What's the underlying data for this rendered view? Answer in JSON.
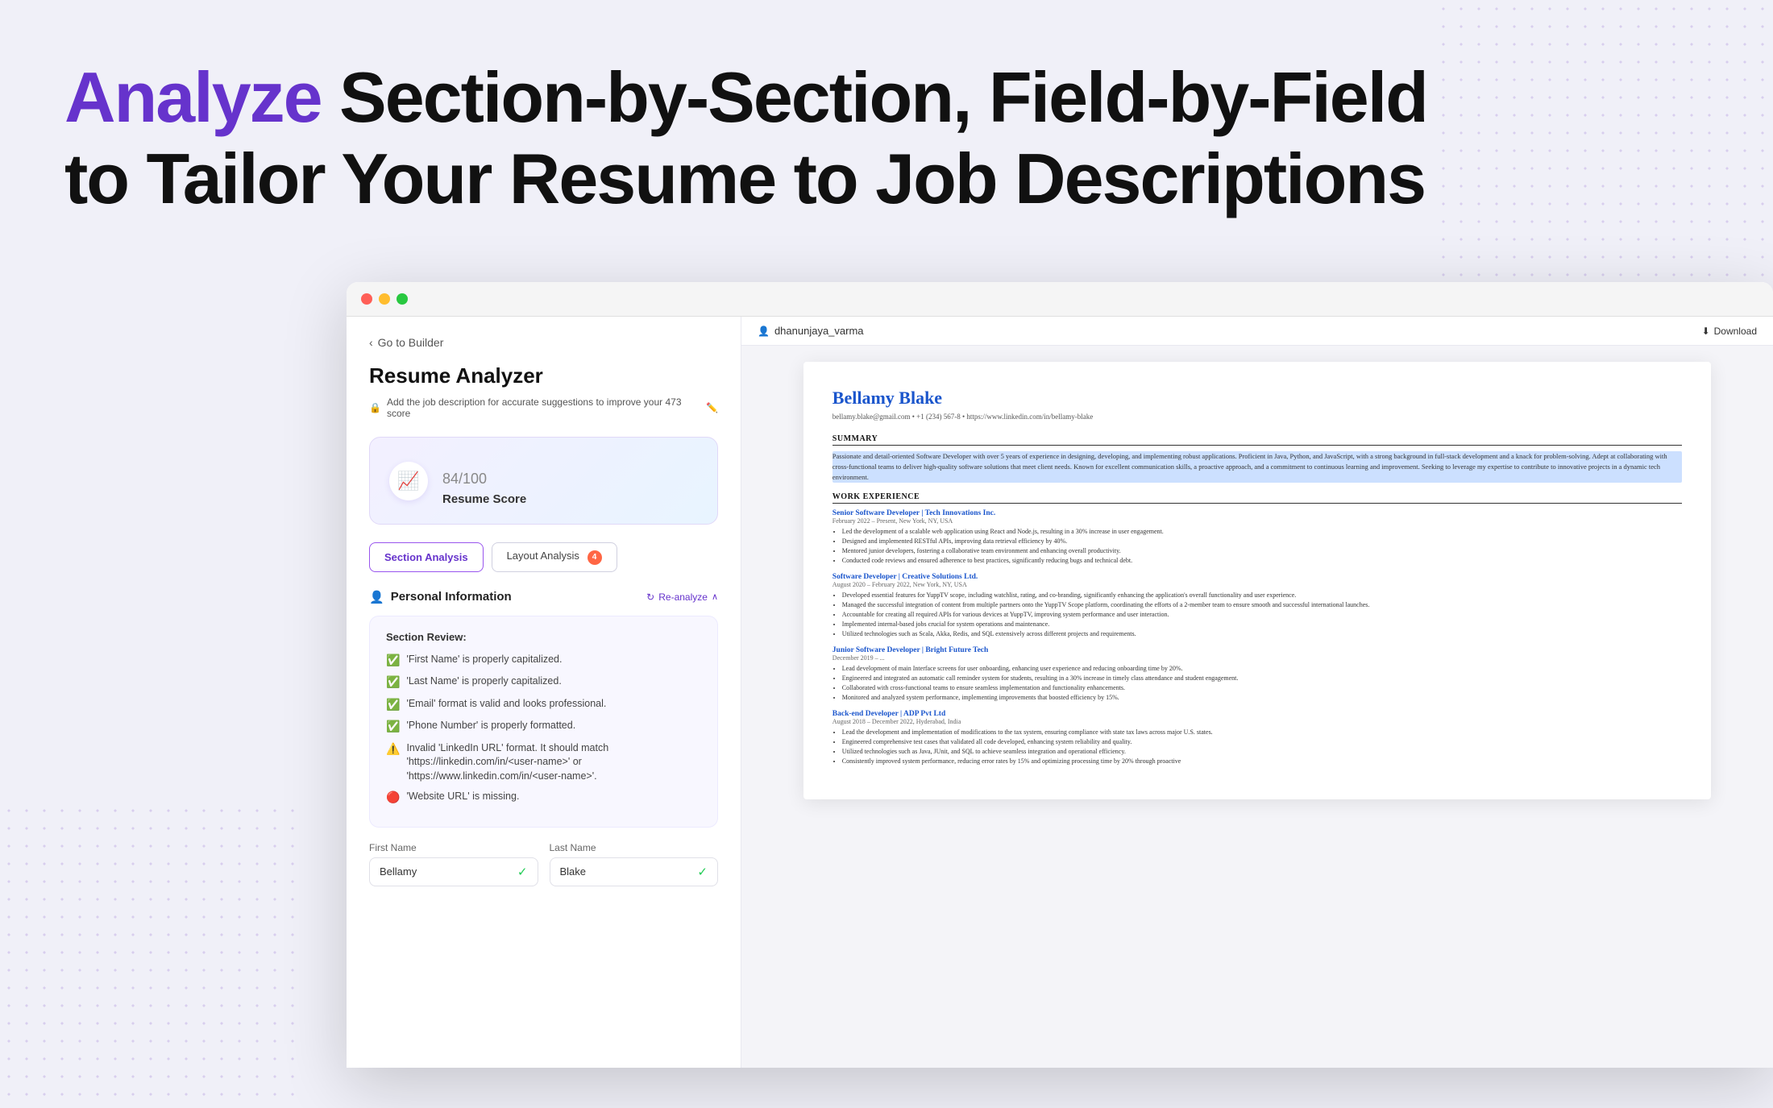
{
  "page": {
    "background_color": "#f0f0f8"
  },
  "headline": {
    "part1": "Analyze",
    "part2": " Section-by-Section, Field-by-Field",
    "line2": "to Tailor Your Resume to Job Descriptions"
  },
  "browser": {
    "dots": [
      "red",
      "yellow",
      "green"
    ]
  },
  "analyzer": {
    "back_label": "Go to Builder",
    "title": "Resume Analyzer",
    "notice": "Add the job description for accurate suggestions to improve your 473 score",
    "score": {
      "icon": "📈",
      "value": "84",
      "max": "/100",
      "label": "Resume Score"
    },
    "tabs": [
      {
        "label": "Section Analysis",
        "active": true,
        "badge": null
      },
      {
        "label": "Layout Analysis",
        "active": false,
        "badge": "4"
      }
    ],
    "personal_section": {
      "title": "Personal Information",
      "re_analyze_label": "Re-analyze",
      "review_title": "Section Review:",
      "review_items": [
        {
          "type": "green",
          "text": "'First Name' is properly capitalized."
        },
        {
          "type": "green",
          "text": "'Last Name' is properly capitalized."
        },
        {
          "type": "green",
          "text": "'Email' format is valid and looks professional."
        },
        {
          "type": "green",
          "text": "'Phone Number' is properly formatted."
        },
        {
          "type": "orange",
          "text": "Invalid 'LinkedIn URL' format. It should match 'https://linkedin.com/in/<user-name>' or 'https://www.linkedin.com/in/<user-name>'."
        },
        {
          "type": "red",
          "text": "'Website URL' is missing."
        }
      ],
      "fields": [
        {
          "label": "First Name",
          "value": "Bellamy",
          "valid": true
        },
        {
          "label": "Last Name",
          "value": "Blake",
          "valid": true
        }
      ]
    }
  },
  "preview": {
    "username": "dhanunjaya_varma",
    "download_label": "Download",
    "resume": {
      "name": "Bellamy Blake",
      "contact": "bellamy.blake@gmail.com  •  +1 (234) 567-8  •  https://www.linkedin.com/in/bellamy-blake",
      "summary_title": "SUMMARY",
      "summary": "Passionate and detail-oriented Software Developer with over 5 years of experience in designing, developing, and implementing robust applications. Proficient in Java, Python, and JavaScript, with a strong background in full-stack development and a knack for problem-solving. Adept at collaborating with cross-functional teams to deliver high-quality software solutions that meet client needs. Known for excellent communication skills, a proactive approach, and a commitment to continuous learning and improvement. Seeking to leverage my expertise to contribute to innovative projects in a dynamic tech environment.",
      "sections": [
        {
          "title": "WORK EXPERIENCE",
          "jobs": [
            {
              "title": "Senior Software Developer | Tech Innovations Inc.",
              "meta": "February 2022 – Present, New York, NY, USA",
              "bullets": [
                "Led the development of a scalable web application using React and Node.js, resulting in a 30% increase in user engagement.",
                "Designed and implemented RESTful APIs, improving data retrieval efficiency by 40%.",
                "Mentored junior developers, fostering a collaborative team environment and enhancing overall productivity.",
                "Conducted code reviews and ensured adherence to best practices, significantly reducing bugs and technical debt."
              ]
            },
            {
              "title": "Software Developer | Creative Solutions Ltd.",
              "meta": "August 2020 – February 2022, New York, NY, USA",
              "bullets": [
                "Developed essential features for YuppTV scope, including watchlist, rating, and co-branding, significantly enhancing the application's overall functionality and user experience.",
                "Managed the successful integration of content from multiple partners onto the YuppTV Scope platform, coordinating the efforts of a 2-member team to ensure smooth and successful international launches.",
                "Accountable for creating all required APIs for various devices at YuppTV, improving system performance and user interaction.",
                "Implemented internal-based jobs crucial for system operations and maintenance.",
                "Utilized technologies such as Scala, Akka, Redis, and SQL extensively across different projects and requirements."
              ]
            },
            {
              "title": "Junior Software Developer | Bright Future Tech",
              "meta": "December 2019 – ...",
              "bullets": [
                "Lead development of main Interface screens for user onboarding, enhancing user experience and reducing onboarding time by 20%.",
                "Engineered and integrated an automatic call reminder system for students, resulting in a 30% increase in timely class attendance and student engagement.",
                "Collaborated with cross-functional teams to ensure seamless implementation and functionality enhancements.",
                "Monitored and analyzed system performance, implementing improvements that boosted efficiency by 15%."
              ]
            },
            {
              "title": "Back-end Developer | ADP Pvt Ltd",
              "meta": "August 2018 – December 2022, Hyderabad, India",
              "bullets": [
                "Lead the development and implementation of modifications to the tax system, ensuring compliance with state tax laws across major U.S. states.",
                "Engineered comprehensive test cases that validated all code developed, enhancing system reliability and quality.",
                "Utilized technologies such as Java, JUnit, and SQL to achieve seamless integration and operational efficiency.",
                "Consistently improved system performance, reducing error rates by 15% and optimizing processing time by 20% through proactive"
              ]
            }
          ]
        }
      ]
    }
  }
}
